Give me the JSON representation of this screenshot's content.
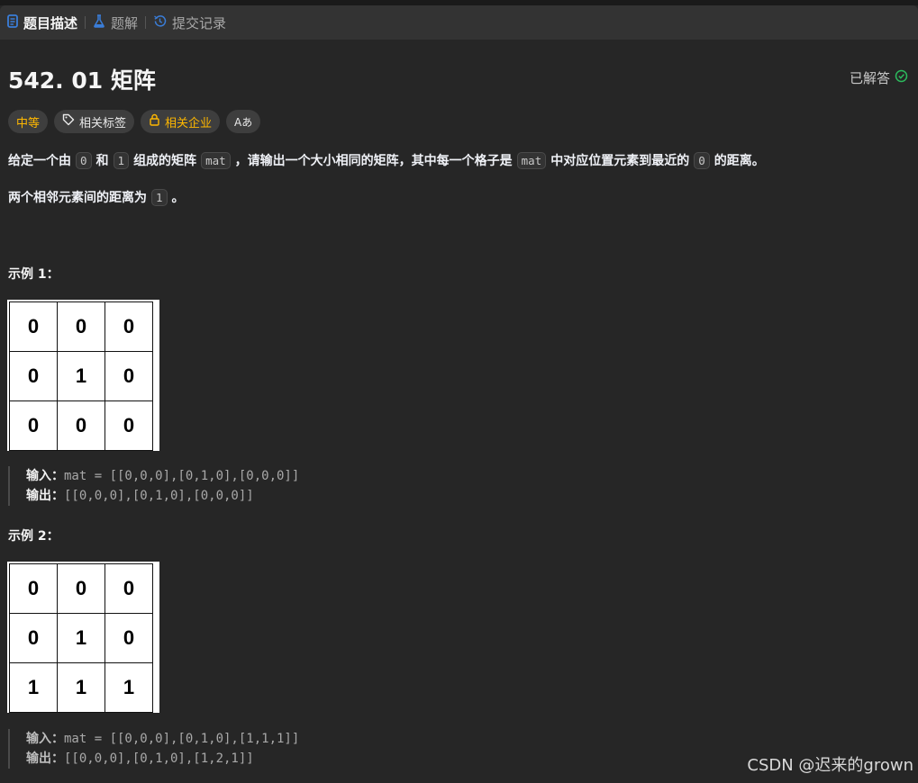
{
  "tabs": [
    {
      "label": "题目描述",
      "icon": "description-icon",
      "active": true
    },
    {
      "label": "题解",
      "icon": "flask-icon",
      "active": false
    },
    {
      "label": "提交记录",
      "icon": "history-icon",
      "active": false
    }
  ],
  "problem": {
    "title": "542. 01 矩阵",
    "status": "已解答",
    "tags": {
      "difficulty": "中等",
      "topics": "相关标签",
      "companies": "相关企业",
      "font_button": "Aあ"
    },
    "paragraph1": {
      "t1": "给定一个由",
      "c1": "0",
      "t2": "和",
      "c2": "1",
      "t3": "组成的矩阵",
      "c3": "mat",
      "t4": "，请输出一个大小相同的矩阵，其中每一个格子是",
      "c4": "mat",
      "t5": "中对应位置元素到最近的",
      "c5": "0",
      "t6": "的距离。"
    },
    "paragraph2": {
      "t1": "两个相邻元素间的距离为",
      "c1": "1",
      "t2": "。"
    }
  },
  "examples": [
    {
      "heading": "示例 1：",
      "grid": [
        [
          "0",
          "0",
          "0"
        ],
        [
          "0",
          "1",
          "0"
        ],
        [
          "0",
          "0",
          "0"
        ]
      ],
      "input_label": "输入：",
      "input_value": "mat = [[0,0,0],[0,1,0],[0,0,0]]",
      "output_label": "输出：",
      "output_value": "[[0,0,0],[0,1,0],[0,0,0]]"
    },
    {
      "heading": "示例 2：",
      "grid": [
        [
          "0",
          "0",
          "0"
        ],
        [
          "0",
          "1",
          "0"
        ],
        [
          "1",
          "1",
          "1"
        ]
      ],
      "input_label": "输入：",
      "input_value": "mat = [[0,0,0],[0,1,0],[1,1,1]]",
      "output_label": "输出：",
      "output_value": "[[0,0,0],[0,1,0],[1,2,1]]"
    }
  ],
  "watermark": "CSDN @迟来的grown",
  "colors": {
    "background": "#262626",
    "tabbar": "#333333",
    "difficulty": "#ffb800",
    "solved_check": "#2cbb5d",
    "tab_icon": "#3a7dd8"
  }
}
